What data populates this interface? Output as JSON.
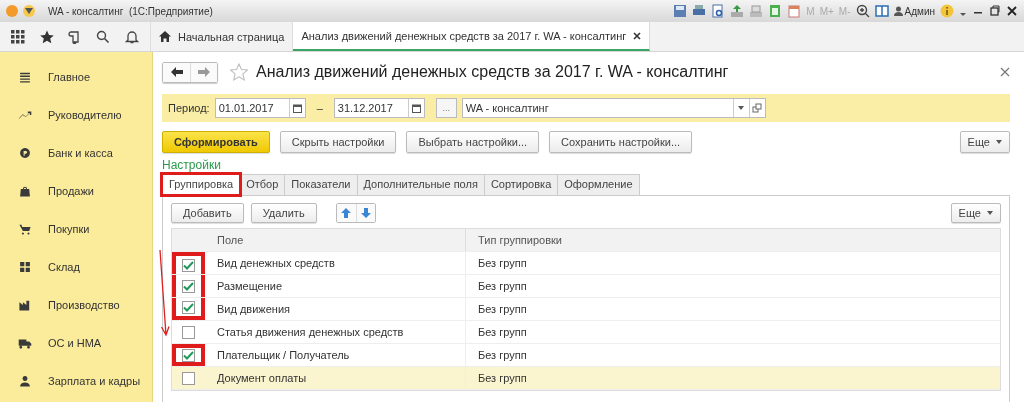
{
  "window": {
    "title": "WA - консалтинг  (1С:Предприятие)",
    "memory": [
      "M",
      "M+",
      "M-"
    ],
    "user": "Админ"
  },
  "open_tabs": [
    {
      "label": "Начальная страница",
      "kind": "home",
      "selected": false
    },
    {
      "label": "Анализ движений денежных средств за 2017 г. WA - консалтинг",
      "kind": "document",
      "selected": true
    }
  ],
  "sidebar": {
    "items": [
      {
        "label": "Главное"
      },
      {
        "label": "Руководителю"
      },
      {
        "label": "Банк и касса"
      },
      {
        "label": "Продажи"
      },
      {
        "label": "Покупки"
      },
      {
        "label": "Склад"
      },
      {
        "label": "Производство"
      },
      {
        "label": "ОС и НМА"
      },
      {
        "label": "Зарплата и кадры"
      }
    ]
  },
  "report": {
    "title": "Анализ движений денежных средств за 2017 г. WA - консалтинг",
    "period": {
      "label": "Период:",
      "from": "01.01.2017",
      "dash": "–",
      "to": "31.12.2017",
      "choose": "...",
      "organization": "WA - консалтинг"
    },
    "buttons": [
      {
        "label": "Сформировать",
        "kind": "primary"
      },
      {
        "label": "Скрыть настройки",
        "kind": "normal"
      },
      {
        "label": "Выбрать настройки...",
        "kind": "normal"
      },
      {
        "label": "Сохранить настройки...",
        "kind": "normal"
      }
    ],
    "more": "Еще",
    "settings_title": "Настройки",
    "settings_tabs": [
      {
        "label": "Группировка",
        "selected": true,
        "highlighted": true
      },
      {
        "label": "Отбор",
        "selected": false,
        "highlighted": false
      },
      {
        "label": "Показатели",
        "selected": false,
        "highlighted": false
      },
      {
        "label": "Дополнительные поля",
        "selected": false,
        "highlighted": false
      },
      {
        "label": "Сортировка",
        "selected": false,
        "highlighted": false
      },
      {
        "label": "Оформление",
        "selected": false,
        "highlighted": false
      }
    ],
    "toolbar": {
      "add": "Добавить",
      "delete": "Удалить",
      "more": "Еще"
    },
    "table": {
      "columns": [
        "Поле",
        "Тип группировки"
      ],
      "rows": [
        {
          "field": "Вид денежных средств",
          "type": "Без групп",
          "checked": true,
          "highlighted": true,
          "selected": false
        },
        {
          "field": "Размещение",
          "type": "Без групп",
          "checked": true,
          "highlighted": true,
          "selected": false
        },
        {
          "field": "Вид движения",
          "type": "Без групп",
          "checked": true,
          "highlighted": true,
          "selected": false
        },
        {
          "field": "Статья движения денежных средств",
          "type": "Без групп",
          "checked": false,
          "highlighted": false,
          "selected": false
        },
        {
          "field": "Плательщик / Получатель",
          "type": "Без групп",
          "checked": true,
          "highlighted": true,
          "selected": false
        },
        {
          "field": "Документ оплаты",
          "type": "Без групп",
          "checked": false,
          "highlighted": false,
          "selected": true
        }
      ]
    }
  }
}
